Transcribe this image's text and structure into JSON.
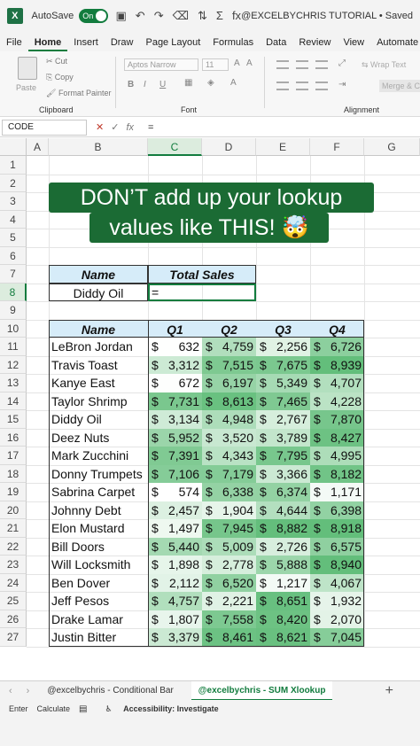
{
  "app": {
    "logo": "X",
    "autosave_label": "AutoSave",
    "autosave_state": "On",
    "doc_title": "@EXCELBYCHRIS TUTORIAL • Saved"
  },
  "qat_icons": [
    "save-icon",
    "undo-icon",
    "redo-icon",
    "clear-format-icon",
    "sort-icon",
    "sum-icon",
    "fx-icon"
  ],
  "qat_glyphs": [
    "▣",
    "↶",
    "↷",
    "⌫",
    "⇅",
    "Σ",
    "fx"
  ],
  "ribbon_tabs": [
    "File",
    "Home",
    "Insert",
    "Draw",
    "Page Layout",
    "Formulas",
    "Data",
    "Review",
    "View",
    "Automate"
  ],
  "ribbon": {
    "paste": "Paste",
    "cut": "Cut",
    "copy": "Copy",
    "format_painter": "Format Painter",
    "clipboard_label": "Clipboard",
    "font_name": "Aptos Narrow",
    "font_size": "11",
    "font_label": "Font",
    "wrap_text": "Wrap Text",
    "merge_center": "Merge & C",
    "alignment_label": "Alignment",
    "bold": "B",
    "italic": "I",
    "underline": "U"
  },
  "formula_bar": {
    "name_box": "CODE",
    "cancel": "✕",
    "enter": "✓",
    "fx": "fx",
    "value": "="
  },
  "columns": [
    "A",
    "B",
    "C",
    "D",
    "E",
    "F",
    "G"
  ],
  "selected_column": "C",
  "rows": [
    "1",
    "2",
    "3",
    "4",
    "5",
    "6",
    "7",
    "8",
    "9",
    "10",
    "11",
    "12",
    "13",
    "14",
    "15",
    "16",
    "17",
    "18",
    "19",
    "20",
    "21",
    "22",
    "23",
    "24",
    "25",
    "26",
    "27"
  ],
  "selected_row": "8",
  "banner": {
    "line1": "DON’T add up your lookup",
    "line2": "values like THIS! 🤯"
  },
  "lookup_table": {
    "header_name": "Name",
    "header_total": "Total Sales",
    "name_value": "Diddy Oil",
    "formula_value": "=",
    "header_fill": "#d6ecf9"
  },
  "sales_table": {
    "headers": [
      "Name",
      "Q1",
      "Q2",
      "Q3",
      "Q4"
    ],
    "rows": [
      {
        "name": "LeBron Jordan",
        "q": [
          "632",
          "4,759",
          "2,256",
          "6,726"
        ]
      },
      {
        "name": "Travis Toast",
        "q": [
          "3,312",
          "7,515",
          "7,675",
          "8,939"
        ]
      },
      {
        "name": "Kanye East",
        "q": [
          "672",
          "6,197",
          "5,349",
          "4,707"
        ]
      },
      {
        "name": "Taylor Shrimp",
        "q": [
          "7,731",
          "8,613",
          "7,465",
          "4,228"
        ]
      },
      {
        "name": "Diddy Oil",
        "q": [
          "3,134",
          "4,948",
          "2,767",
          "7,870"
        ]
      },
      {
        "name": "Deez Nuts",
        "q": [
          "5,952",
          "3,520",
          "3,789",
          "8,427"
        ]
      },
      {
        "name": "Mark Zucchini",
        "q": [
          "7,391",
          "4,343",
          "7,795",
          "4,995"
        ]
      },
      {
        "name": "Donny Trumpets",
        "q": [
          "7,106",
          "7,179",
          "3,366",
          "8,182"
        ]
      },
      {
        "name": "Sabrina Carpet",
        "q": [
          "574",
          "6,338",
          "6,374",
          "1,171"
        ]
      },
      {
        "name": "Johnny Debt",
        "q": [
          "2,457",
          "1,904",
          "4,644",
          "6,398"
        ]
      },
      {
        "name": "Elon Mustard",
        "q": [
          "1,497",
          "7,945",
          "8,882",
          "8,918"
        ]
      },
      {
        "name": "Bill Doors",
        "q": [
          "5,440",
          "5,009",
          "2,726",
          "6,575"
        ]
      },
      {
        "name": "Will Locksmith",
        "q": [
          "1,898",
          "2,778",
          "5,888",
          "8,940"
        ]
      },
      {
        "name": "Ben Dover",
        "q": [
          "2,112",
          "6,520",
          "1,217",
          "4,067"
        ]
      },
      {
        "name": "Jeff Pesos",
        "q": [
          "4,757",
          "2,221",
          "8,651",
          "1,932"
        ]
      },
      {
        "name": "Drake Lamar",
        "q": [
          "1,807",
          "7,558",
          "8,420",
          "2,070"
        ]
      },
      {
        "name": "Justin Bitter",
        "q": [
          "3,379",
          "8,461",
          "8,621",
          "7,045"
        ]
      }
    ],
    "currency": "$",
    "color_scale": {
      "low": "#ffffff",
      "high": "#63be7b"
    }
  },
  "sheet_tabs": [
    "@excelbychris - Conditional Bar",
    "@excelbychris - SUM Xlookup"
  ],
  "active_sheet": 1,
  "add_sheet": "+",
  "status": {
    "mode": "Enter",
    "calc": "Calculate",
    "accessibility": "Accessibility: Investigate"
  },
  "colors": {
    "accent": "#127c3e",
    "banner_bg": "#1b6b34"
  }
}
